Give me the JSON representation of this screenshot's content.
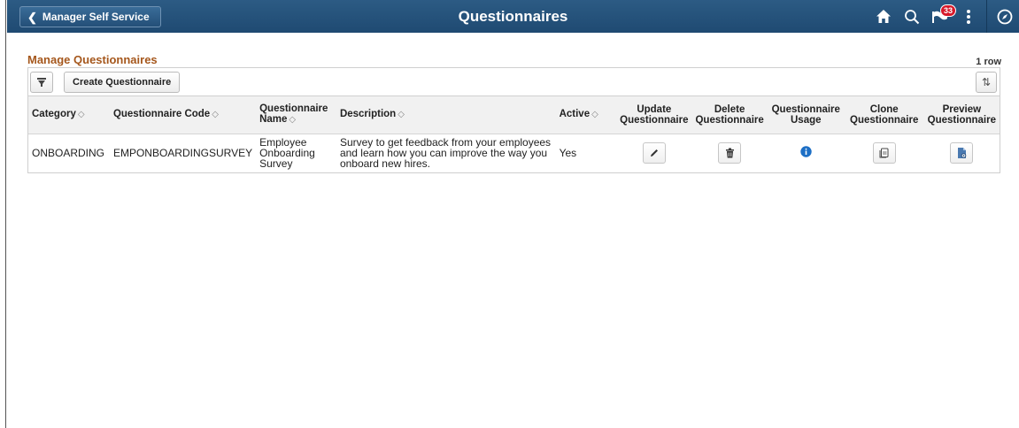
{
  "header": {
    "back_label": "Manager Self Service",
    "title": "Questionnaires",
    "notification_count": "33",
    "icons": [
      "home-icon",
      "search-icon",
      "notification-flag-icon",
      "actions-menu-icon",
      "navbar-icon"
    ],
    "bar_color": "#24507a"
  },
  "section": {
    "title": "Manage Questionnaires",
    "row_count": "1 row",
    "title_color": "#a5571c"
  },
  "toolbar": {
    "create_label": "Create Questionnaire"
  },
  "table": {
    "headers": {
      "category": "Category",
      "code": "Questionnaire Code",
      "name_line1": "Questionnaire",
      "name_line2": "Name",
      "description": "Description",
      "active": "Active",
      "update_line1": "Update",
      "update_line2": "Questionnaire",
      "delete_line1": "Delete",
      "delete_line2": "Questionnaire",
      "usage_line1": "Questionnaire",
      "usage_line2": "Usage",
      "clone_line1": "Clone",
      "clone_line2": "Questionnaire",
      "preview_line1": "Preview",
      "preview_line2": "Questionnaire"
    },
    "rows": [
      {
        "category": "ONBOARDING",
        "code": "EMPONBOARDINGSURVEY",
        "name_line1": "Employee",
        "name_line2": "Onboarding",
        "name_line3": "Survey",
        "desc_line1": "Survey to get feedback from your employees",
        "desc_line2": "and learn how you can improve the way you",
        "desc_line3": "onboard new hires.",
        "active": "Yes"
      }
    ]
  }
}
